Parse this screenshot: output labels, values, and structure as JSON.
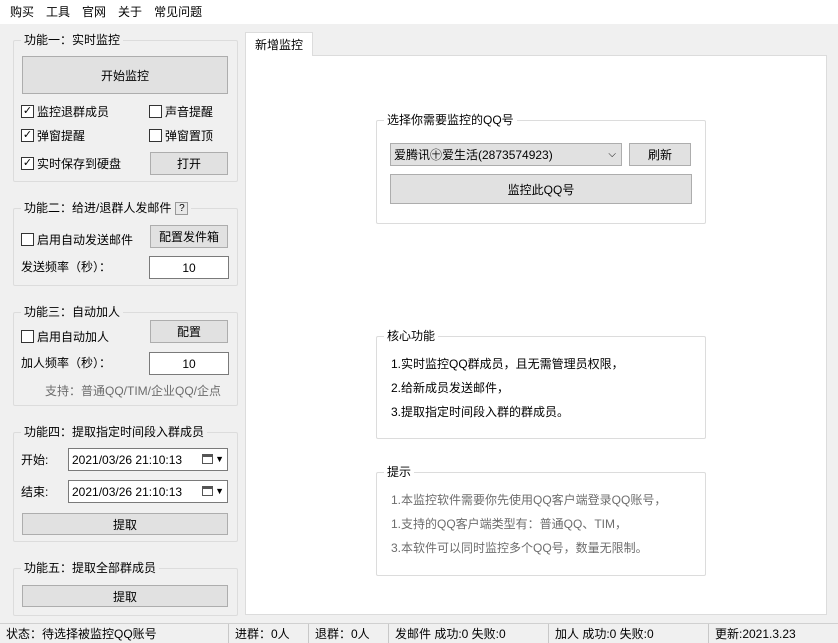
{
  "menu": [
    "购买",
    "工具",
    "官网",
    "关于",
    "常见问题"
  ],
  "f1": {
    "title": "功能一：实时监控",
    "start_btn": "开始监控",
    "cb_quit": "监控退群成员",
    "cb_sound": "声音提醒",
    "cb_popup": "弹窗提醒",
    "cb_top": "弹窗置顶",
    "cb_save": "实时保存到硬盘",
    "open_btn": "打开",
    "check_mark": "✓"
  },
  "f2": {
    "title": "功能二：给进/退群人发邮件",
    "help": "?",
    "cb_auto_mail": "启用自动发送邮件",
    "config_btn": "配置发件箱",
    "freq_label": "发送频率（秒）：",
    "freq_value": "10"
  },
  "f3": {
    "title": "功能三：自动加人",
    "cb_auto_add": "启用自动加人",
    "config_btn": "配置",
    "freq_label": "加人频率（秒）：",
    "freq_value": "10",
    "support": "支持：普通QQ/TIM/企业QQ/企点"
  },
  "f4": {
    "title": "功能四：提取指定时间段入群成员",
    "start_label": "开始:",
    "start_value": "2021/03/26 21:10:13",
    "end_label": "结束:",
    "end_value": "2021/03/26 21:10:13",
    "extract_btn": "提取"
  },
  "f5": {
    "title": "功能五：提取全部群成员",
    "extract_btn": "提取"
  },
  "tab": {
    "label": "新增监控"
  },
  "select_group": {
    "title": "选择你需要监控的QQ号",
    "account": "爱腾讯㊉爱生活(2873574923)",
    "refresh_btn": "刷新",
    "monitor_btn": "监控此QQ号"
  },
  "core": {
    "title": "核心功能",
    "lines": [
      "1.实时监控QQ群成员，且无需管理员权限，",
      "2.给新成员发送邮件，",
      "3.提取指定时间段入群的群成员。"
    ]
  },
  "tips": {
    "title": "提示",
    "lines": [
      "1.本监控软件需要你先使用QQ客户端登录QQ账号，",
      "1.支持的QQ客户端类型有：普通QQ、TIM，",
      "3.本软件可以同时监控多个QQ号，数量无限制。"
    ]
  },
  "status": {
    "state": "状态：待选择被监控QQ账号",
    "join": "进群：0人",
    "quit": "退群：0人",
    "mail": "发邮件 成功:0 失败:0",
    "add": "加人 成功:0 失败:0",
    "update": "更新:2021.3.23"
  }
}
